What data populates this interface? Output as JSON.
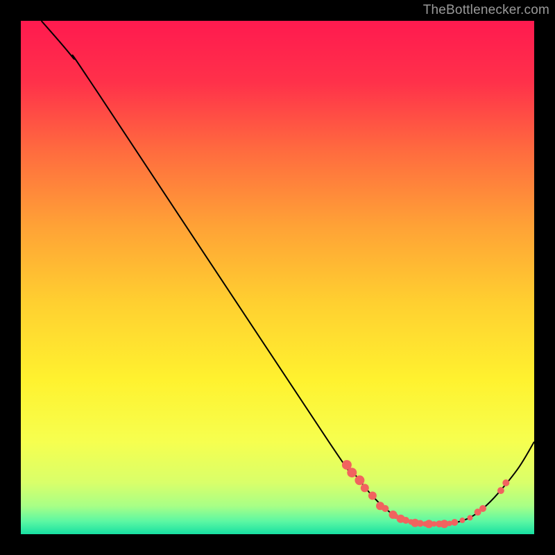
{
  "watermark": "TheBottlenecker.com",
  "chart_data": {
    "type": "line",
    "title": "",
    "xlabel": "",
    "ylabel": "",
    "xlim": [
      0,
      100
    ],
    "ylim": [
      0,
      100
    ],
    "curve": [
      {
        "x": 4,
        "y": 100
      },
      {
        "x": 10,
        "y": 93
      },
      {
        "x": 15,
        "y": 86
      },
      {
        "x": 60,
        "y": 18
      },
      {
        "x": 64,
        "y": 13
      },
      {
        "x": 68,
        "y": 8
      },
      {
        "x": 71,
        "y": 5
      },
      {
        "x": 74,
        "y": 3
      },
      {
        "x": 78,
        "y": 2
      },
      {
        "x": 83,
        "y": 2
      },
      {
        "x": 87,
        "y": 3
      },
      {
        "x": 90,
        "y": 5
      },
      {
        "x": 93,
        "y": 8
      },
      {
        "x": 97,
        "y": 13
      },
      {
        "x": 100,
        "y": 18
      }
    ],
    "markers": [
      {
        "x": 63.5,
        "y": 13.5,
        "r": 7
      },
      {
        "x": 64.5,
        "y": 12.0,
        "r": 7
      },
      {
        "x": 66.0,
        "y": 10.5,
        "r": 7
      },
      {
        "x": 67.0,
        "y": 9.0,
        "r": 6
      },
      {
        "x": 68.5,
        "y": 7.5,
        "r": 6
      },
      {
        "x": 70.0,
        "y": 5.5,
        "r": 6
      },
      {
        "x": 71.0,
        "y": 5.0,
        "r": 5
      },
      {
        "x": 72.5,
        "y": 3.8,
        "r": 6
      },
      {
        "x": 73.0,
        "y": 3.5,
        "r": 4
      },
      {
        "x": 74.0,
        "y": 3.0,
        "r": 6
      },
      {
        "x": 75.0,
        "y": 2.7,
        "r": 5
      },
      {
        "x": 76.0,
        "y": 2.4,
        "r": 4
      },
      {
        "x": 76.8,
        "y": 2.2,
        "r": 6
      },
      {
        "x": 77.8,
        "y": 2.1,
        "r": 5
      },
      {
        "x": 78.8,
        "y": 2.0,
        "r": 4
      },
      {
        "x": 79.5,
        "y": 2.0,
        "r": 6
      },
      {
        "x": 80.5,
        "y": 2.0,
        "r": 4
      },
      {
        "x": 81.5,
        "y": 2.0,
        "r": 5
      },
      {
        "x": 82.5,
        "y": 2.0,
        "r": 6
      },
      {
        "x": 83.5,
        "y": 2.1,
        "r": 4
      },
      {
        "x": 84.5,
        "y": 2.3,
        "r": 5
      },
      {
        "x": 86.0,
        "y": 2.7,
        "r": 4
      },
      {
        "x": 87.5,
        "y": 3.2,
        "r": 4
      },
      {
        "x": 89.0,
        "y": 4.3,
        "r": 5
      },
      {
        "x": 90.0,
        "y": 5.0,
        "r": 5
      },
      {
        "x": 93.5,
        "y": 8.5,
        "r": 5
      },
      {
        "x": 94.5,
        "y": 10.0,
        "r": 5
      }
    ],
    "gradient_stops": [
      {
        "offset": 0.0,
        "color": "#ff1a4f"
      },
      {
        "offset": 0.12,
        "color": "#ff314a"
      },
      {
        "offset": 0.25,
        "color": "#ff6a3f"
      },
      {
        "offset": 0.4,
        "color": "#ffa236"
      },
      {
        "offset": 0.55,
        "color": "#ffd030"
      },
      {
        "offset": 0.7,
        "color": "#fff22f"
      },
      {
        "offset": 0.82,
        "color": "#f6ff4f"
      },
      {
        "offset": 0.9,
        "color": "#d9ff6a"
      },
      {
        "offset": 0.945,
        "color": "#a8ff86"
      },
      {
        "offset": 0.975,
        "color": "#5cf7a3"
      },
      {
        "offset": 1.0,
        "color": "#17e0a2"
      }
    ],
    "marker_color": "#f1635f",
    "line_color": "#000000"
  }
}
